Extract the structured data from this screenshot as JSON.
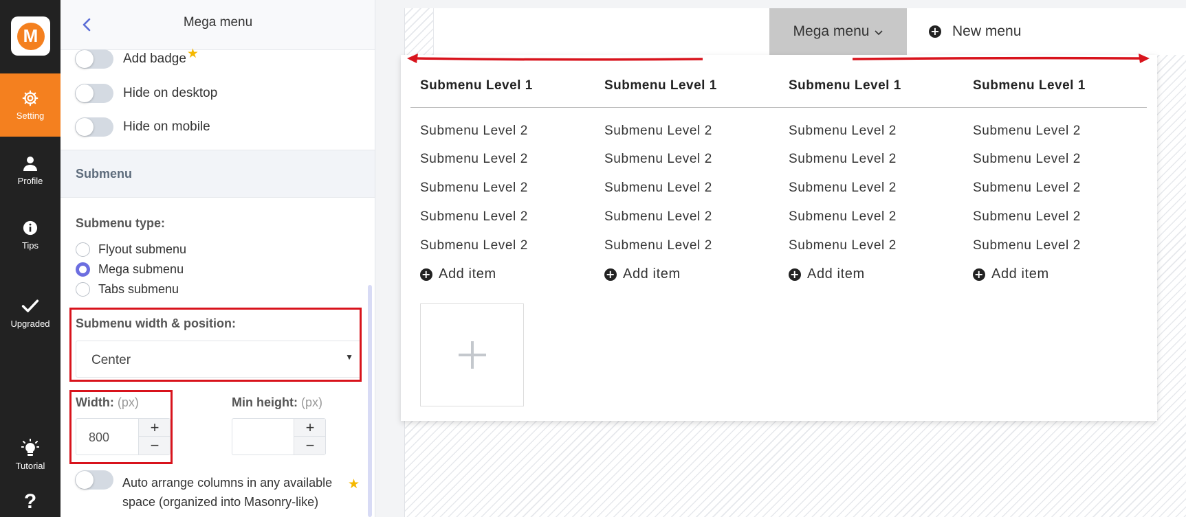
{
  "rail": {
    "logo_letter": "M",
    "setting": "Setting",
    "profile": "Profile",
    "tips": "Tips",
    "upgraded": "Upgraded",
    "tutorial": "Tutorial",
    "help": "?"
  },
  "panel": {
    "title": "Mega menu",
    "toggles": {
      "add_badge": "Add badge",
      "hide_desktop": "Hide on desktop",
      "hide_mobile": "Hide on mobile"
    },
    "section": "Submenu",
    "submenu_type_label": "Submenu type:",
    "submenu_types": [
      "Flyout submenu",
      "Mega submenu",
      "Tabs submenu"
    ],
    "selected_type": "Mega submenu",
    "width_position_label": "Submenu width & position:",
    "width_position_value": "Center",
    "width_label": "Width:",
    "width_unit": "(px)",
    "width_value": "800",
    "min_height_label": "Min height:",
    "min_height_unit": "(px)",
    "min_height_value": "",
    "auto_arrange_label": "Auto arrange columns in any available space (organized into Masonry-like)"
  },
  "preview": {
    "menu_items": {
      "mega": "Mega menu",
      "new_menu": "New menu"
    },
    "columns": [
      {
        "heading": "Submenu Level 1",
        "items": [
          "Submenu Level 2",
          "Submenu Level 2",
          "Submenu Level 2",
          "Submenu Level 2",
          "Submenu Level 2"
        ],
        "add": "Add item"
      },
      {
        "heading": "Submenu Level 1",
        "items": [
          "Submenu Level 2",
          "Submenu Level 2",
          "Submenu Level 2",
          "Submenu Level 2",
          "Submenu Level 2"
        ],
        "add": "Add item"
      },
      {
        "heading": "Submenu Level 1",
        "items": [
          "Submenu Level 2",
          "Submenu Level 2",
          "Submenu Level 2",
          "Submenu Level 2",
          "Submenu Level 2"
        ],
        "add": "Add item"
      },
      {
        "heading": "Submenu Level 1",
        "items": [
          "Submenu Level 2",
          "Submenu Level 2",
          "Submenu Level 2",
          "Submenu Level 2",
          "Submenu Level 2"
        ],
        "add": "Add item"
      }
    ]
  },
  "colors": {
    "accent_orange": "#f4801f",
    "highlight_red": "#d8131c",
    "radio_purple": "#6c6ee0",
    "rail_bg": "#222222"
  },
  "icons": [
    "logo-icon",
    "gear-icon",
    "user-icon",
    "info-icon",
    "check-icon",
    "lightbulb-icon",
    "help-icon",
    "back-chevron-icon",
    "star-icon",
    "chevron-down-icon",
    "plus-circle-icon",
    "plus-icon"
  ]
}
